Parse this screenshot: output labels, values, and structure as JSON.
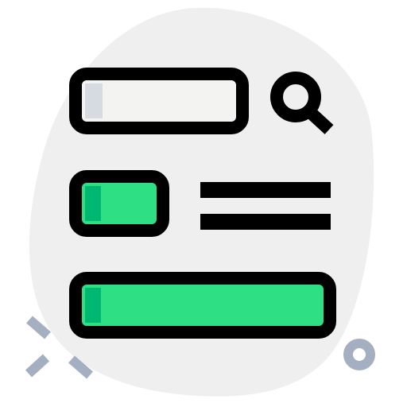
{
  "icon": {
    "semantic": "search-results-layout-icon",
    "parts": [
      "blob-background",
      "search-bar",
      "search-icon",
      "thumbnail-block",
      "text-lines",
      "result-bar",
      "sparkle-decoration",
      "ring-decoration"
    ]
  },
  "colors": {
    "blob": "#efefef",
    "outline": "#000000",
    "search_fill": "#f3f3f1",
    "search_shade": "#d5dbe1",
    "accent_green": "#2fdf84",
    "accent_green_dark": "#00b871",
    "decoration": "#a4afc1"
  }
}
